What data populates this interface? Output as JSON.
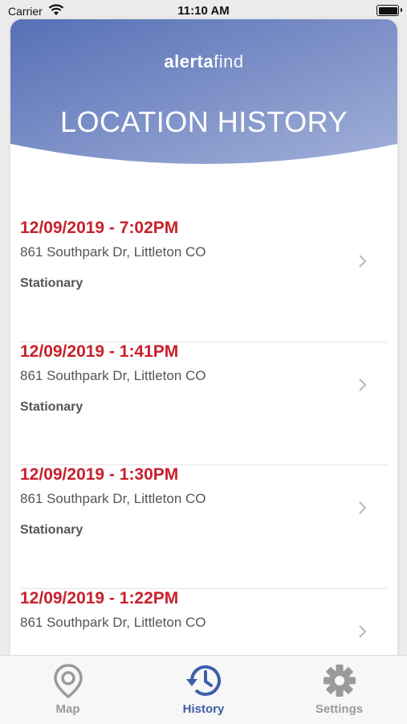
{
  "status_bar": {
    "carrier": "Carrier",
    "time": "11:10 AM"
  },
  "header": {
    "logo_bold": "alerta",
    "logo_light": "find",
    "title": "LOCATION HISTORY"
  },
  "colors": {
    "accent": "#3e5fa8",
    "date_red": "#c8202b",
    "header_top": "#5b73b8",
    "header_bottom": "#98a8d3"
  },
  "history": [
    {
      "date": "12/09/2019 - 7:02PM",
      "address": "861 Southpark Dr, Littleton CO",
      "status": "Stationary"
    },
    {
      "date": "12/09/2019 - 1:41PM",
      "address": "861 Southpark Dr, Littleton CO",
      "status": "Stationary"
    },
    {
      "date": "12/09/2019 - 1:30PM",
      "address": "861 Southpark Dr, Littleton CO",
      "status": "Stationary"
    },
    {
      "date": "12/09/2019 - 1:22PM",
      "address": "861 Southpark Dr, Littleton CO",
      "status": ""
    }
  ],
  "tabs": [
    {
      "label": "Map",
      "icon": "map-pin-icon",
      "active": false
    },
    {
      "label": "History",
      "icon": "history-icon",
      "active": true
    },
    {
      "label": "Settings",
      "icon": "gear-icon",
      "active": false
    }
  ]
}
